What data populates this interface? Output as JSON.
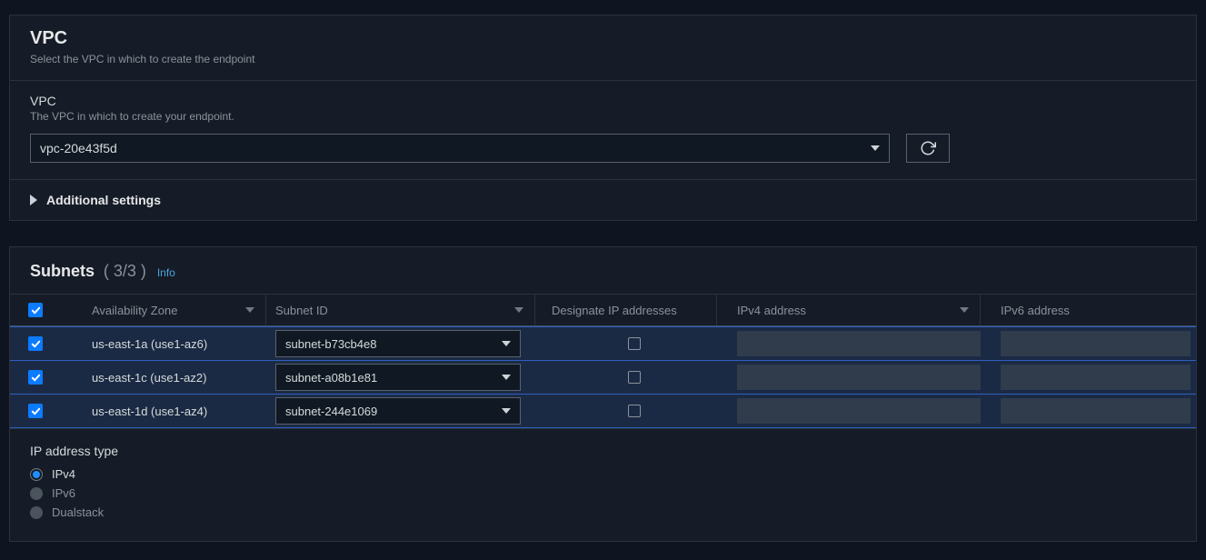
{
  "vpc": {
    "title": "VPC",
    "subtitle": "Select the VPC in which to create the endpoint",
    "field_label": "VPC",
    "field_desc": "The VPC in which to create your endpoint.",
    "selected": "vpc-20e43f5d",
    "additional_settings": "Additional settings"
  },
  "subnets": {
    "title": "Subnets",
    "count": "( 3/3 )",
    "info": "Info",
    "columns": {
      "az": "Availability Zone",
      "subnet_id": "Subnet ID",
      "designate_ip": "Designate IP addresses",
      "ipv4": "IPv4 address",
      "ipv6": "IPv6 address"
    },
    "rows": [
      {
        "checked": true,
        "az": "us-east-1a (use1-az6)",
        "subnet": "subnet-b73cb4e8",
        "designate": false
      },
      {
        "checked": true,
        "az": "us-east-1c (use1-az2)",
        "subnet": "subnet-a08b1e81",
        "designate": false
      },
      {
        "checked": true,
        "az": "us-east-1d (use1-az4)",
        "subnet": "subnet-244e1069",
        "designate": false
      }
    ]
  },
  "ip_type": {
    "title": "IP address type",
    "options": [
      {
        "label": "IPv4",
        "selected": true,
        "enabled": true
      },
      {
        "label": "IPv6",
        "selected": false,
        "enabled": false
      },
      {
        "label": "Dualstack",
        "selected": false,
        "enabled": false
      }
    ]
  }
}
